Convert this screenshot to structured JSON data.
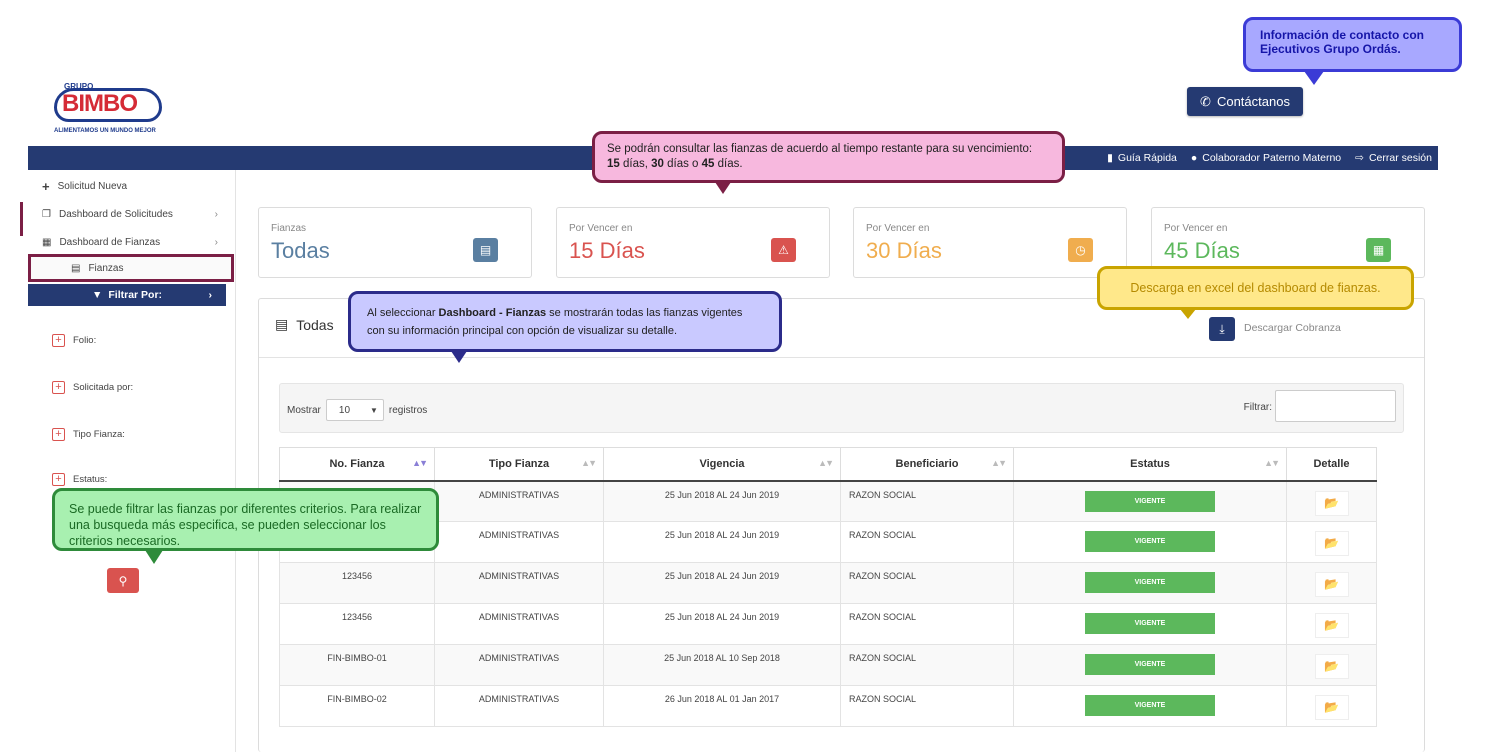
{
  "logo": {
    "grupo": "GRUPO",
    "word": "BIMBO",
    "tagline": "ALIMENTAMOS UN MUNDO MEJOR"
  },
  "contact_button": {
    "label": "Contáctanos",
    "icon": "phone-icon"
  },
  "topnav": {
    "guide": "Guía Rápida",
    "user": "Colaborador Paterno Materno",
    "logout": "Cerrar sesión"
  },
  "sidebar": {
    "items": [
      {
        "label": "Solicitud Nueva",
        "icon": "plus-icon"
      },
      {
        "label": "Dashboard de Solicitudes",
        "icon": "copy-icon"
      },
      {
        "label": "Dashboard de Fianzas",
        "icon": "table-icon"
      }
    ],
    "sub_item": "Fianzas",
    "filter_title": "Filtrar Por:",
    "criteria": [
      "Folio:",
      "Solicitada por:",
      "Tipo Fianza:",
      "Estatus:"
    ]
  },
  "cards": [
    {
      "label": "Fianzas",
      "value": "Todas",
      "color": "#5a7fa1",
      "icon_bg": "#5a7fa1",
      "icon": "file-icon"
    },
    {
      "label": "Por Vencer en",
      "value": "15 Días",
      "color": "#d9534f",
      "icon_bg": "#d9534f",
      "icon": "warning-icon"
    },
    {
      "label": "Por Vencer en",
      "value": "30 Días",
      "color": "#f0ad4e",
      "icon_bg": "#f0ad4e",
      "icon": "clock-icon"
    },
    {
      "label": "Por Vencer en",
      "value": "45 Días",
      "color": "#5cb85c",
      "icon_bg": "#5cb85c",
      "icon": "grid-icon"
    }
  ],
  "panel": {
    "title": "Todas",
    "download_label": "Descargar Cobranza",
    "show_label": "Mostrar",
    "page_size": "10",
    "records_label": "registros",
    "filter_label": "Filtrar:"
  },
  "table": {
    "headers": [
      "No. Fianza",
      "Tipo Fianza",
      "Vigencia",
      "Beneficiario",
      "Estatus",
      "Detalle"
    ],
    "rows": [
      {
        "no": "",
        "tipo": "ADMINISTRATIVAS",
        "vigencia": "25 Jun 2018 AL 24 Jun 2019",
        "beneficiario": "RAZON SOCIAL",
        "estatus": "VIGENTE"
      },
      {
        "no": "",
        "tipo": "ADMINISTRATIVAS",
        "vigencia": "25 Jun 2018 AL 24 Jun 2019",
        "beneficiario": "RAZON SOCIAL",
        "estatus": "VIGENTE"
      },
      {
        "no": "123456",
        "tipo": "ADMINISTRATIVAS",
        "vigencia": "25 Jun 2018 AL 24 Jun 2019",
        "beneficiario": "RAZON SOCIAL",
        "estatus": "VIGENTE"
      },
      {
        "no": "123456",
        "tipo": "ADMINISTRATIVAS",
        "vigencia": "25 Jun 2018 AL 24 Jun 2019",
        "beneficiario": "RAZON SOCIAL",
        "estatus": "VIGENTE"
      },
      {
        "no": "FIN-BIMBO-01",
        "tipo": "ADMINISTRATIVAS",
        "vigencia": "25 Jun 2018 AL 10 Sep 2018",
        "beneficiario": "RAZON SOCIAL",
        "estatus": "VIGENTE"
      },
      {
        "no": "FIN-BIMBO-02",
        "tipo": "ADMINISTRATIVAS",
        "vigencia": "26 Jun 2018 AL 01 Jan 2017",
        "beneficiario": "RAZON SOCIAL",
        "estatus": "VIGENTE"
      }
    ]
  },
  "callouts": {
    "contact": "Información de contacto con Ejecutivos Grupo Ordás.",
    "dias_intro": "Se podrán consultar las fianzas de acuerdo al tiempo restante para su vencimiento:",
    "dias_15": "15",
    "dias_mid1": " días, ",
    "dias_30": "30",
    "dias_mid2": " días o ",
    "dias_45": "45",
    "dias_end": " días.",
    "excel": "Descarga en excel del dashboard de fianzas.",
    "todas_pre": "Al seleccionar ",
    "todas_bold": "Dashboard - Fianzas",
    "todas_post": " se mostrarán todas las fianzas vigentes con su información principal con opción de visualizar su detalle.",
    "filtro": "Se puede filtrar  las fianzas por diferentes criterios. Para realizar una busqueda más especifica, se pueden seleccionar los criterios necesarios."
  }
}
